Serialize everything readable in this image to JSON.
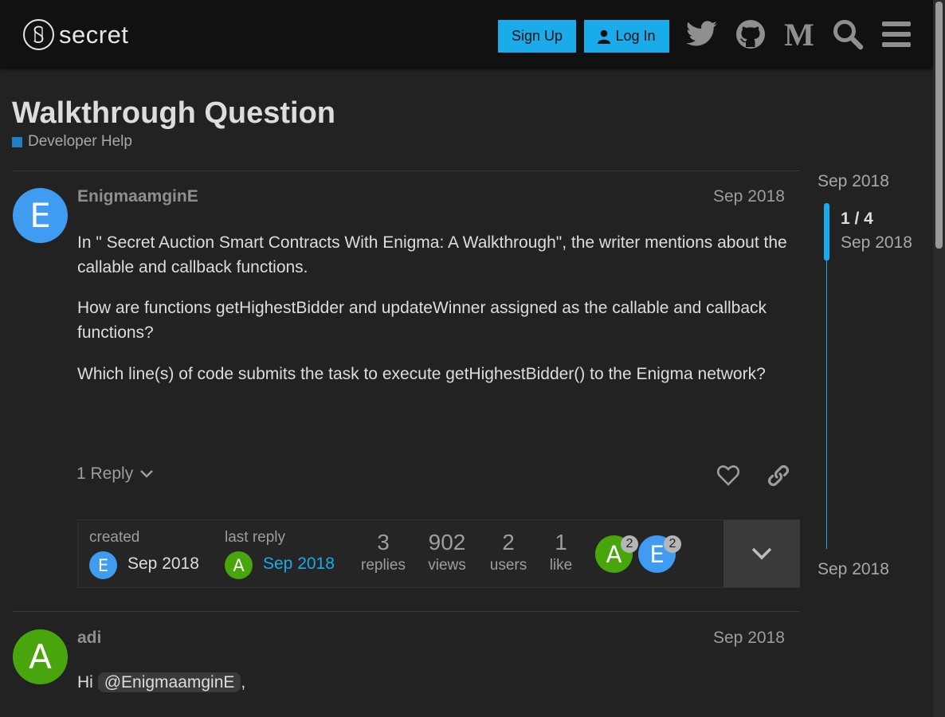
{
  "header": {
    "logo_text": "secret",
    "signup_label": "Sign Up",
    "login_label": "Log In",
    "icons": [
      "twitter-icon",
      "github-icon",
      "medium-icon",
      "search-icon",
      "hamburger-menu-icon"
    ]
  },
  "topic": {
    "title": "Walkthrough Question",
    "category": "Developer Help",
    "category_color": "#1f7ec4"
  },
  "posts": [
    {
      "avatar_letter": "E",
      "username": "EnigmaamginE",
      "date": "Sep 2018",
      "paragraphs": [
        "In \" Secret Auction Smart Contracts With Enigma: A Walkthrough\", the writer mentions about the callable and callback functions.",
        "How are functions getHighestBidder and updateWinner assigned as the callable and callback functions?",
        "Which line(s) of code submits the task to execute getHighestBidder() to the Enigma network?"
      ],
      "replies_label": "1 Reply"
    },
    {
      "avatar_letter": "A",
      "username": "adi",
      "date": "Sep 2018",
      "greeting": "Hi",
      "mention": "@EnigmaamginE",
      "after_mention": ","
    }
  ],
  "topic_map": {
    "created_label": "created",
    "created_date": "Sep 2018",
    "created_avatar": "E",
    "last_reply_label": "last reply",
    "last_reply_date": "Sep 2018",
    "last_reply_avatar": "A",
    "stats": [
      {
        "value": "3",
        "label": "replies"
      },
      {
        "value": "902",
        "label": "views"
      },
      {
        "value": "2",
        "label": "users"
      },
      {
        "value": "1",
        "label": "like"
      }
    ],
    "participants": [
      {
        "letter": "A",
        "count": "2"
      },
      {
        "letter": "E",
        "count": "2"
      }
    ]
  },
  "timeline": {
    "start_date": "Sep 2018",
    "position": "1 / 4",
    "position_date": "Sep 2018",
    "end_date": "Sep 2018"
  },
  "colors": {
    "accent": "#1aabea",
    "avatar_e": "#3f9cf1",
    "avatar_a": "#48a60c"
  }
}
